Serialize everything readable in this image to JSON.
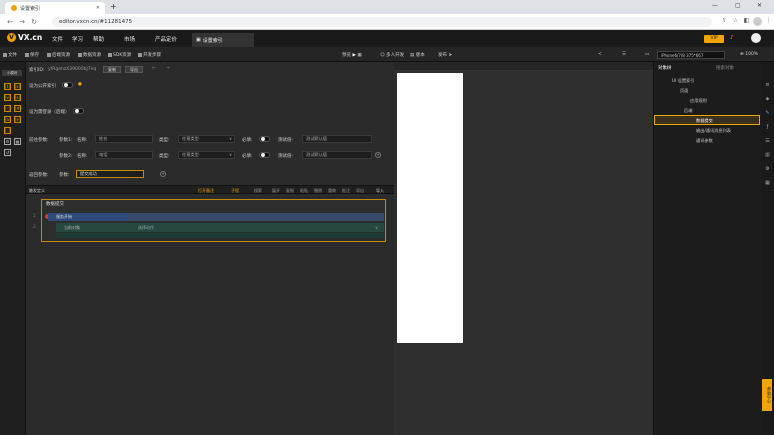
{
  "browser": {
    "tab_title": "设置索引",
    "url": "editor.vxcn.cn/#11281475",
    "new_tab": "+",
    "window_controls": [
      "—",
      "▢",
      "✕"
    ]
  },
  "app": {
    "logo_text": "VX.cn",
    "logo_letter": "V",
    "menus": [
      "文件",
      "学习",
      "帮助",
      "市场",
      "产品定价"
    ],
    "active_tab": "设置索引",
    "vip": "VIP",
    "accent": "#f0a500"
  },
  "toolbar": {
    "left": [
      "文件",
      "保存",
      "后端资源",
      "数据资源",
      "SDK资源",
      "开发步骤"
    ],
    "center": [
      "预览",
      "多人开发",
      "版本",
      "发布"
    ],
    "device": "iPhone6/7/8 375*667",
    "zoom": "100%"
  },
  "rail": {
    "header": "小模块",
    "buttons": [
      "[t]",
      "[s]",
      "[v]",
      "[s]",
      "[-]",
      "[#]",
      "[a]",
      "[e]",
      "[ ]"
    ]
  },
  "main": {
    "index_label": "索引ID:",
    "index_value": "yfRgehzX39000bJ7nq",
    "index_btns": [
      "复制",
      "导出"
    ],
    "public_index_label": "设为公开索引",
    "login_label": "设为需登录（后端）",
    "params_label": "前往参数:",
    "param_label": "参数1:",
    "param2_label": "参数2:",
    "name_label": "名称:",
    "name1": "姓名",
    "name2": "电话",
    "type_label": "类型:",
    "type_value": "任意类型",
    "required_label": "必填:",
    "test_label": "测试值:",
    "test_placeholder": "测试默认值",
    "return_label": "返回参数:",
    "return_param_label": "参数:",
    "return_value": "提交成功",
    "def_label": "触发定义",
    "def_tabs": [
      "打开备注",
      "子程",
      "搜索",
      "展开",
      "复制",
      "粘贴",
      "撤销",
      "重做",
      "批注",
      "导出",
      "导入"
    ],
    "block_title": "数据提交",
    "block_row1": "服务开始",
    "block_row2": "当前对象",
    "block_row2b": "选择动作",
    "side_nums": [
      "1",
      "2"
    ]
  },
  "right_panel": {
    "tabs": [
      "对象树",
      "搜索对象"
    ],
    "tree": [
      "UI 设置索引",
      "页面",
      "应用规则",
      "后端",
      "数据提交",
      "输出/通讯消息列表",
      "通讯参数"
    ]
  },
  "help_label": "帮助中心"
}
